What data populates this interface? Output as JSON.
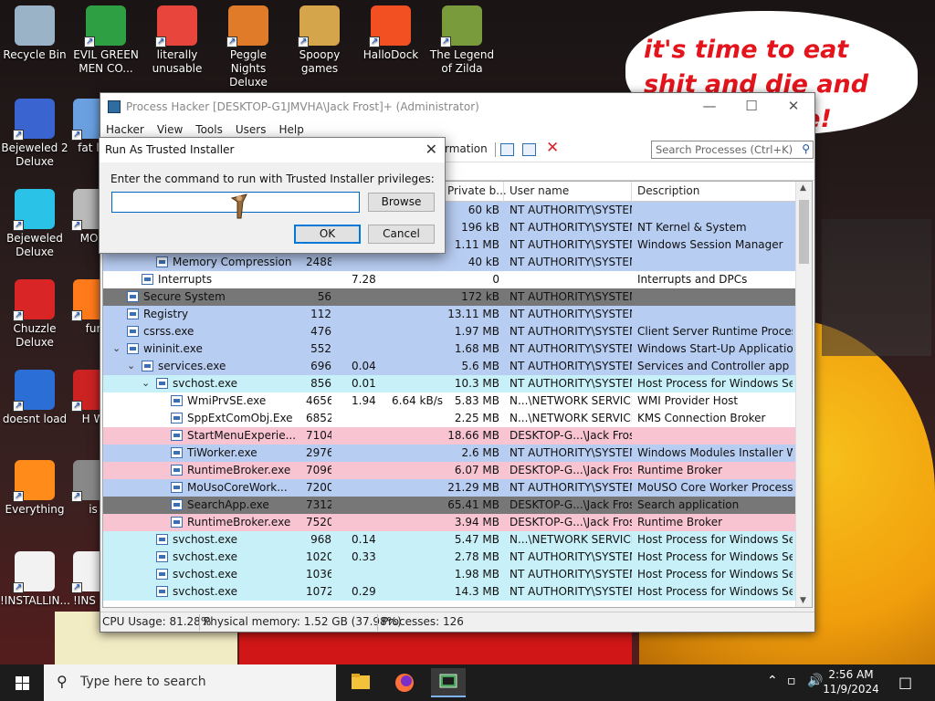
{
  "desktop": {
    "meme_text": "it's time to eat shit and die and go trick vote!",
    "icons": [
      {
        "label": "Recycle Bin",
        "color": "#9bb3c7"
      },
      {
        "label": "EVIL GREEN MEN CO...",
        "color": "#2ea043"
      },
      {
        "label": "literally unusable",
        "color": "#e8453c"
      },
      {
        "label": "Peggle Nights Deluxe",
        "color": "#e07b2a"
      },
      {
        "label": "Spoopy games",
        "color": "#d4a54a"
      },
      {
        "label": "HalloDock",
        "color": "#f25022"
      },
      {
        "label": "The Legend of Zilda",
        "color": "#7a9b3c"
      },
      {
        "label": "Bejeweled 2 Deluxe",
        "color": "#3a64d0"
      },
      {
        "label": "fat lik",
        "color": "#6aa0e0"
      },
      {
        "label": "Bejeweled Deluxe",
        "color": "#2bc2e8"
      },
      {
        "label": "MON",
        "color": "#bbbbbb"
      },
      {
        "label": "Chuzzle Deluxe",
        "color": "#d92525"
      },
      {
        "label": "fur",
        "color": "#ff7a1a"
      },
      {
        "label": "doesnt load",
        "color": "#2b6fd6"
      },
      {
        "label": "H W",
        "color": "#cc2222"
      },
      {
        "label": "Everything",
        "color": "#ff8c1a"
      },
      {
        "label": "is",
        "color": "#888888"
      },
      {
        "label": "!INSTALLIN...",
        "color": "#f2f2f2"
      },
      {
        "label": "!INS -Si",
        "color": "#f2f2f2"
      }
    ]
  },
  "process_hacker": {
    "title": "Process Hacker [DESKTOP-G1JMVHA\\Jack Frost]+ (Administrator)",
    "menu": [
      "Hacker",
      "View",
      "Tools",
      "Users",
      "Help"
    ],
    "toolbar_info": "rmation",
    "search_placeholder": "Search Processes (Ctrl+K)",
    "columns": {
      "private": "Private b...",
      "user": "User name",
      "desc": "Description"
    },
    "rows": [
      {
        "name": "",
        "pid": "",
        "cpu": "",
        "io": "",
        "priv": "60 kB",
        "user": "NT AUTHORITY\\SYSTEM",
        "desc": "",
        "color": "#b8cdf2",
        "indent": 0
      },
      {
        "name": "",
        "pid": "",
        "cpu": "",
        "io": "",
        "priv": "196 kB",
        "user": "NT AUTHORITY\\SYSTEM",
        "desc": "NT Kernel & System",
        "color": "#b8cdf2",
        "indent": 0
      },
      {
        "name": "",
        "pid": "",
        "cpu": "",
        "io": "",
        "priv": "1.11 MB",
        "user": "NT AUTHORITY\\SYSTEM",
        "desc": "Windows Session Manager",
        "color": "#b8cdf2",
        "indent": 0
      },
      {
        "name": "Memory Compression",
        "pid": "2488",
        "cpu": "",
        "io": "",
        "priv": "40 kB",
        "user": "NT AUTHORITY\\SYSTEM",
        "desc": "",
        "color": "#b8cdf2",
        "indent": 3
      },
      {
        "name": "Interrupts",
        "pid": "",
        "cpu": "7.28",
        "io": "",
        "priv": "0",
        "user": "",
        "desc": "Interrupts and DPCs",
        "color": "#ffffff",
        "indent": 2
      },
      {
        "name": "Secure System",
        "pid": "56",
        "cpu": "",
        "io": "",
        "priv": "172 kB",
        "user": "NT AUTHORITY\\SYSTEM",
        "desc": "",
        "color": "#777777",
        "indent": 1
      },
      {
        "name": "Registry",
        "pid": "112",
        "cpu": "",
        "io": "",
        "priv": "13.11 MB",
        "user": "NT AUTHORITY\\SYSTEM",
        "desc": "",
        "color": "#b8cdf2",
        "indent": 1
      },
      {
        "name": "csrss.exe",
        "pid": "476",
        "cpu": "",
        "io": "",
        "priv": "1.97 MB",
        "user": "NT AUTHORITY\\SYSTEM",
        "desc": "Client Server Runtime Process",
        "color": "#b8cdf2",
        "indent": 1
      },
      {
        "name": "wininit.exe",
        "pid": "552",
        "cpu": "",
        "io": "",
        "priv": "1.68 MB",
        "user": "NT AUTHORITY\\SYSTEM",
        "desc": "Windows Start-Up Application",
        "color": "#b8cdf2",
        "indent": 1,
        "chev": true
      },
      {
        "name": "services.exe",
        "pid": "696",
        "cpu": "0.04",
        "io": "",
        "priv": "5.6 MB",
        "user": "NT AUTHORITY\\SYSTEM",
        "desc": "Services and Controller app",
        "color": "#b8cdf2",
        "indent": 2,
        "chev": true
      },
      {
        "name": "svchost.exe",
        "pid": "856",
        "cpu": "0.01",
        "io": "",
        "priv": "10.3 MB",
        "user": "NT AUTHORITY\\SYSTEM",
        "desc": "Host Process for Windows Ser...",
        "color": "#c8f0f8",
        "indent": 3,
        "chev": true
      },
      {
        "name": "WmiPrvSE.exe",
        "pid": "4656",
        "cpu": "1.94",
        "io": "6.64 kB/s",
        "priv": "5.83 MB",
        "user": "N...\\NETWORK SERVICE",
        "desc": "WMI Provider Host",
        "color": "#ffffff",
        "indent": 4
      },
      {
        "name": "SppExtComObj.Exe",
        "pid": "6852",
        "cpu": "",
        "io": "",
        "priv": "2.25 MB",
        "user": "N...\\NETWORK SERVICE",
        "desc": "KMS Connection Broker",
        "color": "#ffffff",
        "indent": 4
      },
      {
        "name": "StartMenuExperie...",
        "pid": "7104",
        "cpu": "",
        "io": "",
        "priv": "18.66 MB",
        "user": "DESKTOP-G...\\Jack Frost",
        "desc": "",
        "color": "#f8c4d2",
        "indent": 4
      },
      {
        "name": "TiWorker.exe",
        "pid": "2976",
        "cpu": "",
        "io": "",
        "priv": "2.6 MB",
        "user": "NT AUTHORITY\\SYSTEM",
        "desc": "Windows Modules Installer W...",
        "color": "#b8cdf2",
        "indent": 4
      },
      {
        "name": "RuntimeBroker.exe",
        "pid": "7096",
        "cpu": "",
        "io": "",
        "priv": "6.07 MB",
        "user": "DESKTOP-G...\\Jack Frost",
        "desc": "Runtime Broker",
        "color": "#f8c4d2",
        "indent": 4
      },
      {
        "name": "MoUsoCoreWork...",
        "pid": "7200",
        "cpu": "",
        "io": "",
        "priv": "21.29 MB",
        "user": "NT AUTHORITY\\SYSTEM",
        "desc": "MoUSO Core Worker Process",
        "color": "#b8cdf2",
        "indent": 4
      },
      {
        "name": "SearchApp.exe",
        "pid": "7312",
        "cpu": "",
        "io": "",
        "priv": "65.41 MB",
        "user": "DESKTOP-G...\\Jack Frost",
        "desc": "Search application",
        "color": "#777777",
        "indent": 4
      },
      {
        "name": "RuntimeBroker.exe",
        "pid": "7520",
        "cpu": "",
        "io": "",
        "priv": "3.94 MB",
        "user": "DESKTOP-G...\\Jack Frost",
        "desc": "Runtime Broker",
        "color": "#f8c4d2",
        "indent": 4
      },
      {
        "name": "svchost.exe",
        "pid": "968",
        "cpu": "0.14",
        "io": "",
        "priv": "5.47 MB",
        "user": "N...\\NETWORK SERVICE",
        "desc": "Host Process for Windows Ser...",
        "color": "#c8f0f8",
        "indent": 3
      },
      {
        "name": "svchost.exe",
        "pid": "1020",
        "cpu": "0.33",
        "io": "",
        "priv": "2.78 MB",
        "user": "NT AUTHORITY\\SYSTEM",
        "desc": "Host Process for Windows Ser...",
        "color": "#c8f0f8",
        "indent": 3
      },
      {
        "name": "svchost.exe",
        "pid": "1036",
        "cpu": "",
        "io": "",
        "priv": "1.98 MB",
        "user": "NT AUTHORITY\\SYSTEM",
        "desc": "Host Process for Windows Ser...",
        "color": "#c8f0f8",
        "indent": 3
      },
      {
        "name": "svchost.exe",
        "pid": "1072",
        "cpu": "0.29",
        "io": "",
        "priv": "14.3 MB",
        "user": "NT AUTHORITY\\SYSTEM",
        "desc": "Host Process for Windows Ser...",
        "color": "#c8f0f8",
        "indent": 3
      }
    ],
    "status": {
      "cpu": "CPU Usage: 81.28%",
      "mem": "Physical memory: 1.52 GB (37.98%)",
      "procs": "Processes: 126"
    }
  },
  "dialog": {
    "title": "Run As Trusted Installer",
    "prompt": "Enter the command to run with Trusted Installer privileges:",
    "input_value": "",
    "browse": "Browse",
    "ok": "OK",
    "cancel": "Cancel"
  },
  "taskbar": {
    "search_placeholder": "Type here to search",
    "time": "2:56 AM",
    "date": "11/9/2024"
  }
}
